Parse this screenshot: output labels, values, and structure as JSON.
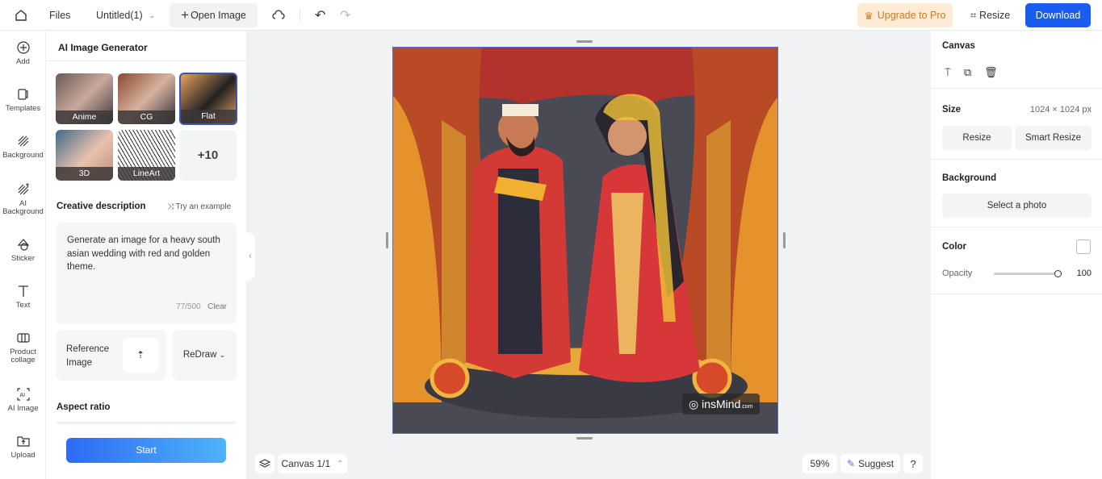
{
  "topbar": {
    "files": "Files",
    "doc_title": "Untitled(1)",
    "open_image": "Open Image",
    "upgrade": "Upgrade to Pro",
    "resize": "Resize",
    "download": "Download",
    "accent": "#1a5cf0"
  },
  "rail": [
    {
      "label": "Add",
      "icon": "plus-circle"
    },
    {
      "label": "Templates",
      "icon": "templates"
    },
    {
      "label": "Background",
      "icon": "hatch"
    },
    {
      "label": "AI Background",
      "icon": "ai-hatch"
    },
    {
      "label": "Sticker",
      "icon": "sticker"
    },
    {
      "label": "Text",
      "icon": "text"
    },
    {
      "label": "Product collage",
      "icon": "collage"
    },
    {
      "label": "AI Image",
      "icon": "ai-image"
    },
    {
      "label": "Upload",
      "icon": "upload"
    }
  ],
  "panel": {
    "title": "AI Image Generator",
    "styles": [
      {
        "label": "Anime"
      },
      {
        "label": "CG"
      },
      {
        "label": "Flat",
        "selected": true
      },
      {
        "label": "3D"
      },
      {
        "label": "LineArt"
      }
    ],
    "more": "+10",
    "desc_title": "Creative description",
    "try_example": "Try an example",
    "prompt": "Generate an image for a heavy south asian wedding with red and golden theme.",
    "count": "77/500",
    "clear": "Clear",
    "reference": "Reference Image",
    "mode": "ReDraw",
    "aspect_title": "Aspect ratio",
    "start": "Start"
  },
  "canvas": {
    "page": "Canvas 1/1",
    "zoom": "59%",
    "suggest": "Suggest",
    "help": "?",
    "watermark": "insMind",
    "watermark_suffix": ".com"
  },
  "right": {
    "canvas_title": "Canvas",
    "size_label": "Size",
    "size_value": "1024 × 1024 px",
    "resize": "Resize",
    "smart_resize": "Smart Resize",
    "bg_label": "Background",
    "select_photo": "Select a photo",
    "color_label": "Color",
    "opacity_label": "Opacity",
    "opacity_value": "100"
  }
}
